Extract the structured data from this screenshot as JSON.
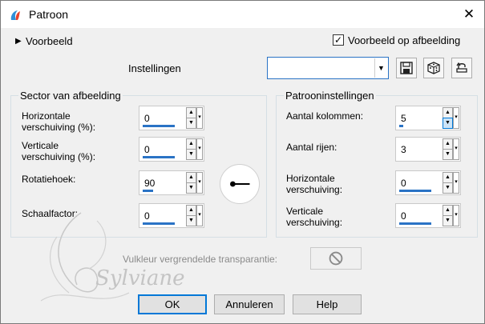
{
  "window": {
    "title": "Patroon",
    "app_icon": "paint-app-icon",
    "close_icon": "close-icon"
  },
  "top": {
    "preview_toggle": "Voorbeeld",
    "preview_on_image": "Voorbeeld op afbeelding",
    "settings_label": "Instellingen",
    "settings_value": "",
    "save_icon": "save-icon",
    "random_icon": "dice-icon",
    "reset_icon": "reset-icon"
  },
  "sector": {
    "title": "Sector van afbeelding",
    "fields": [
      {
        "label_line1": "Horizontale",
        "label_line2": "verschuiving (%):",
        "value": "0",
        "fill": 0.8
      },
      {
        "label_line1": "Verticale",
        "label_line2": "verschuiving (%):",
        "value": "0",
        "fill": 0.8
      },
      {
        "label_line1": "Rotatiehoek:",
        "label_line2": "",
        "value": "90",
        "fill": 0.25
      },
      {
        "label_line1": "Schaalfactor:",
        "label_line2": "",
        "value": "0",
        "fill": 0.8
      }
    ]
  },
  "pattern": {
    "title": "Patrooninstellingen",
    "fields": [
      {
        "label_line1": "Aantal kolommen:",
        "label_line2": "",
        "value": "5",
        "fill": 0.08
      },
      {
        "label_line1": "Aantal rijen:",
        "label_line2": "",
        "value": "3",
        "fill": 0.0
      },
      {
        "label_line1": "Horizontale",
        "label_line2": "verschuiving:",
        "value": "0",
        "fill": 0.8
      },
      {
        "label_line1": "Verticale",
        "label_line2": "verschuiving:",
        "value": "0",
        "fill": 0.8
      }
    ]
  },
  "transparency": {
    "label": "Vulkleur vergrendelde transparantie:",
    "icon": "no-symbol-icon"
  },
  "watermark": {
    "text": "Sylviane"
  },
  "buttons": {
    "ok": "OK",
    "cancel": "Annuleren",
    "help": "Help"
  }
}
